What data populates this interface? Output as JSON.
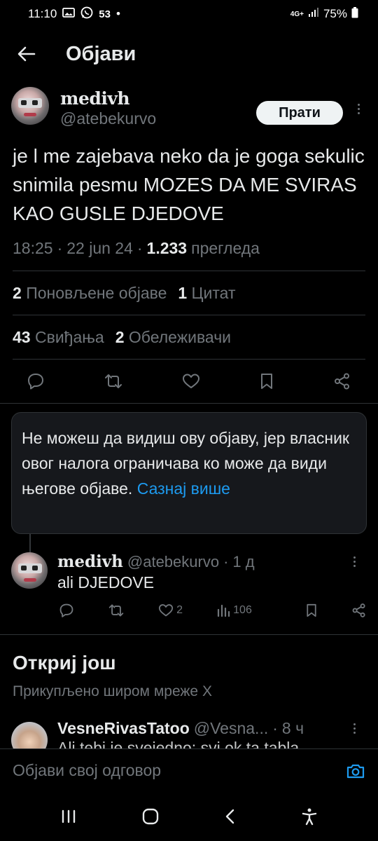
{
  "status_bar": {
    "time": "11:10",
    "notification_count": "53",
    "dot": "•",
    "network": "4G+",
    "battery": "75%"
  },
  "header": {
    "title": "Објави"
  },
  "post": {
    "display_name": "medivh",
    "handle": "@atebekurvo",
    "follow_label": "Прати",
    "text": "je l me zajebava neko da je goga sekulic snimila pesmu MOZES DA ME SVIRAS KAO GUSLE DJEDOVE",
    "time": "18:25",
    "dot": "·",
    "date": "22 jun 24",
    "views": "1.233",
    "views_label": "прегледа",
    "reposts_count": "2",
    "reposts_label": "Поновљене објаве",
    "quotes_count": "1",
    "quotes_label": "Цитат",
    "likes_count": "43",
    "likes_label": "Свиђања",
    "bookmarks_count": "2",
    "bookmarks_label": "Обележивачи"
  },
  "notice": {
    "text": "Не можеш да видиш ову објаву, јер власник овог налога ограничава ко може да види његове објаве. ",
    "link": "Сазнај више"
  },
  "reply": {
    "display_name": "medivh",
    "handle": "@atebekurvo",
    "dot": "·",
    "age": "1 д",
    "text": "ali DJEDOVE",
    "likes": "2",
    "views": "106"
  },
  "discover": {
    "title": "Откриј још",
    "subtitle": "Прикупљено широм мреже X"
  },
  "recommended": {
    "display_name": "VesneRivasTatoo",
    "handle": "@Vesna...",
    "dot": "·",
    "age": "8 ч",
    "text_partial": "Ali tebi je svejedno: svi ok ta tabla..."
  },
  "compose": {
    "placeholder": "Објави свој одговор"
  },
  "colors": {
    "accent": "#1d9bf0",
    "background": "#000000",
    "muted": "#71767b",
    "divider": "#2f3336"
  }
}
